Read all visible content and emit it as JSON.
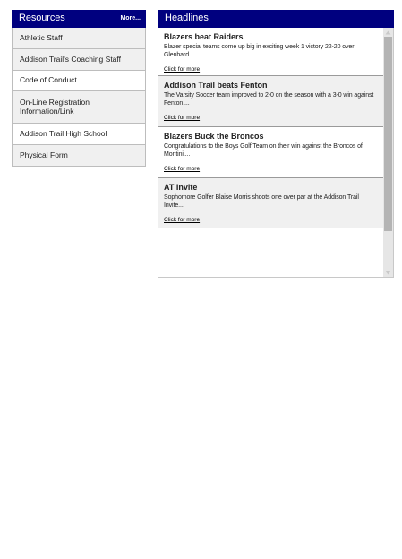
{
  "resources": {
    "title": "Resources",
    "more_label": "More...",
    "items": [
      {
        "label": "Athletic Staff"
      },
      {
        "label": "Addison Trail's Coaching Staff"
      },
      {
        "label": "Code of Conduct"
      },
      {
        "label": "On-Line Registration Information/Link"
      },
      {
        "label": "Addison Trail High School"
      },
      {
        "label": "Physical Form"
      }
    ]
  },
  "headlines": {
    "title": "Headlines",
    "items": [
      {
        "title": "Blazers beat Raiders",
        "body": "Blazer special teams come up big in exciting week 1 victory 22-20 over Glenbard...",
        "link": "Click for more"
      },
      {
        "title": "Addison Trail beats Fenton",
        "body": "The Varsity Soccer team improved to 2-0 on the season with a 3-0 win against Fenton....",
        "link": "Click for more"
      },
      {
        "title": "Blazers Buck the Broncos",
        "body": "Congratulations to the Boys Golf Team on their win against the Broncos of Montini....",
        "link": "Click for more"
      },
      {
        "title": "AT Invite",
        "body": "Sophomore Golfer Blaise Morris shoots one over par at the Addison Trail Invite....",
        "link": "Click for more"
      }
    ]
  },
  "colors": {
    "header_bg": "#00007f",
    "header_text": "#ffffff",
    "row_shade": "#f0f0f0"
  },
  "icons": {
    "scroll_up": "triangle-up-icon",
    "scroll_down": "triangle-down-icon"
  }
}
